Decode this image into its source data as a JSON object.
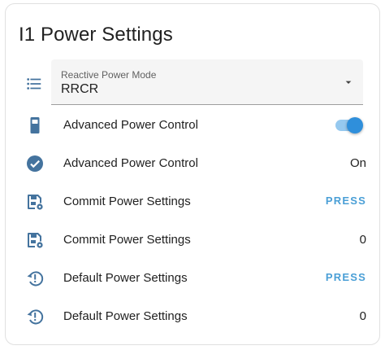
{
  "card": {
    "title": "I1 Power Settings"
  },
  "select": {
    "icon": "format-list-bulleted-icon",
    "label": "Reactive Power Mode",
    "value": "RRCR"
  },
  "rows": [
    {
      "icon": "battery-icon",
      "label": "Advanced Power Control",
      "control": "toggle",
      "checked": true
    },
    {
      "icon": "check-circle-icon",
      "label": "Advanced Power Control",
      "value": "On"
    },
    {
      "icon": "content-save-cog-icon",
      "label": "Commit Power Settings",
      "action": "PRESS"
    },
    {
      "icon": "content-save-cog-icon",
      "label": "Commit Power Settings",
      "value": "0"
    },
    {
      "icon": "restore-alert-icon",
      "label": "Default Power Settings",
      "action": "PRESS"
    },
    {
      "icon": "restore-alert-icon",
      "label": "Default Power Settings",
      "value": "0"
    }
  ],
  "colors": {
    "icon": "#44739e",
    "accent": "#2f8fdb",
    "press": "#4a9fd6"
  }
}
